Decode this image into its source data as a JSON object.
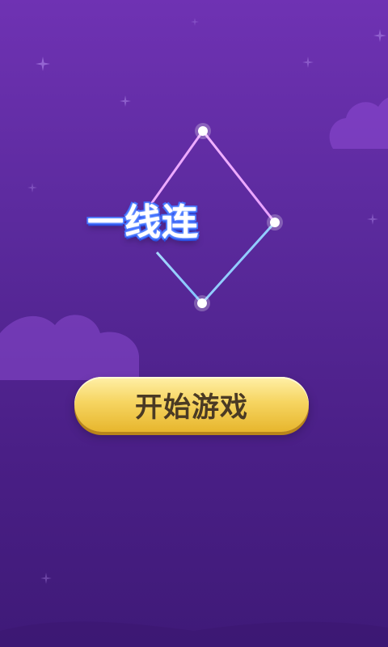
{
  "title": "一线连",
  "start_button": {
    "label": "开始游戏"
  },
  "colors": {
    "background_top": "#6f32b3",
    "background_bottom": "#3f1a78",
    "button_gold": "#f6d562",
    "button_text": "#4a3a24",
    "line_pink": "#f2b3ff",
    "line_blue": "#9fd5ff"
  },
  "icons": [
    "sparkle-icon",
    "cloud-shape",
    "node-dot"
  ]
}
